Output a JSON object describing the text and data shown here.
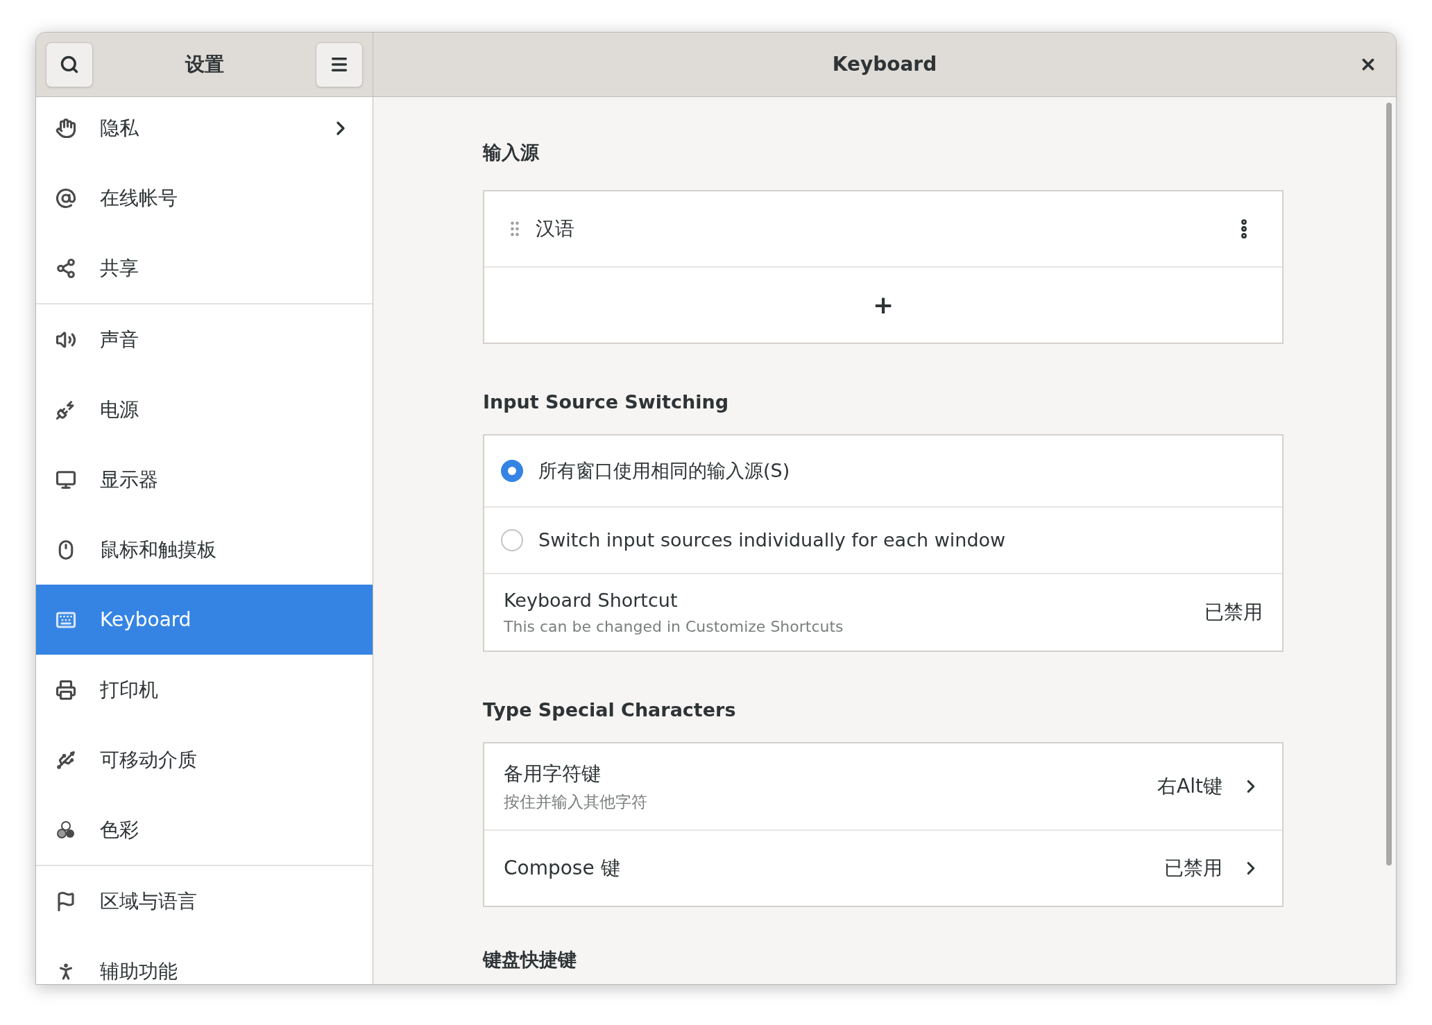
{
  "sidebar_header": {
    "title": "设置"
  },
  "header": {
    "title": "Keyboard"
  },
  "sidebar": {
    "groups": [
      {
        "items": [
          {
            "label": "隐私",
            "selected": false,
            "chevron": true
          },
          {
            "label": "在线帐号",
            "selected": false,
            "chevron": false
          },
          {
            "label": "共享",
            "selected": false,
            "chevron": false
          }
        ]
      },
      {
        "items": [
          {
            "label": "声音",
            "selected": false,
            "chevron": false
          },
          {
            "label": "电源",
            "selected": false,
            "chevron": false
          },
          {
            "label": "显示器",
            "selected": false,
            "chevron": false
          },
          {
            "label": "鼠标和触摸板",
            "selected": false,
            "chevron": false
          },
          {
            "label": "Keyboard",
            "selected": true,
            "chevron": false
          },
          {
            "label": "打印机",
            "selected": false,
            "chevron": false
          },
          {
            "label": "可移动介质",
            "selected": false,
            "chevron": false
          },
          {
            "label": "色彩",
            "selected": false,
            "chevron": false
          }
        ]
      },
      {
        "items": [
          {
            "label": "区域与语言",
            "selected": false,
            "chevron": false
          },
          {
            "label": "辅助功能",
            "selected": false,
            "chevron": false
          }
        ]
      }
    ]
  },
  "input_sources": {
    "heading": "输入源",
    "sources": [
      {
        "label": "汉语"
      }
    ],
    "add_label": "+"
  },
  "switching": {
    "heading": "Input Source Switching",
    "options": [
      {
        "label": "所有窗口使用相同的输入源(S)",
        "selected": true
      },
      {
        "label": "Switch input sources individually for each window",
        "selected": false
      }
    ],
    "shortcut": {
      "title": "Keyboard Shortcut",
      "subtitle": "This can be changed in Customize Shortcuts",
      "value": "已禁用"
    }
  },
  "special_characters": {
    "heading": "Type Special Characters",
    "rows": [
      {
        "title": "备用字符键",
        "subtitle": "按住并输入其他字符",
        "value": "右Alt键"
      },
      {
        "title": "Compose 键",
        "value": "已禁用"
      }
    ]
  },
  "shortcuts": {
    "heading": "键盘快捷键"
  }
}
